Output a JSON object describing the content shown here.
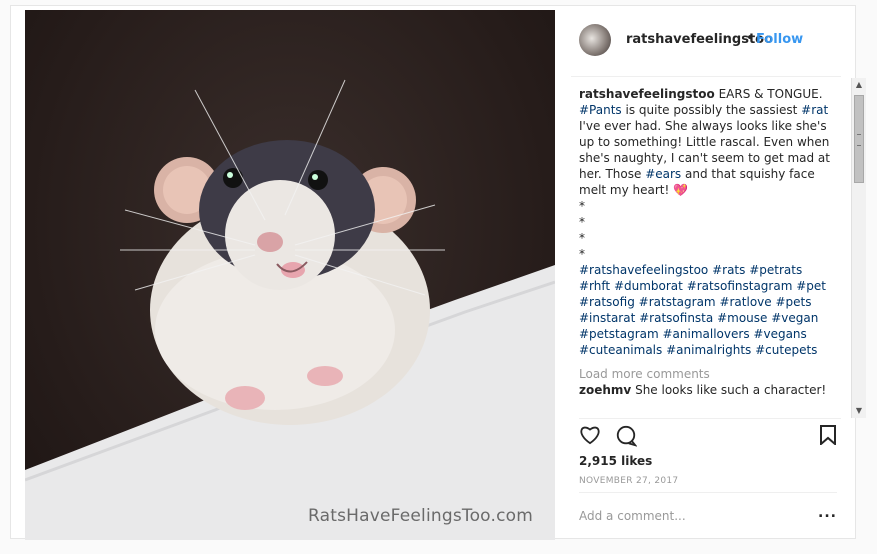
{
  "post": {
    "username": "ratshavefeelingstoo",
    "separator": "•",
    "follow_label": "Follow",
    "watermark": "RatsHaveFeelingsToo.com",
    "caption": {
      "user": "ratshavefeelingstoo",
      "title": "EARS & TONGUE.",
      "tag_pants": "#Pants",
      "text1": "is quite possibly the sassiest",
      "tag_rat": "#rat",
      "text2": "I've ever had. She always looks like she's up to something! Little rascal. Even when she's naughty, I can't seem to get mad at her. Those",
      "tag_ears": "#ears",
      "text3": "and that squishy face melt my heart!",
      "emoji": "💖",
      "stars": [
        "*",
        "*",
        "*",
        "*"
      ],
      "hashtags": [
        "#ratshavefeelingstoo",
        "#rats",
        "#petrats",
        "#rhft",
        "#dumborat",
        "#ratsofinstagram",
        "#pet",
        "#ratsofig",
        "#ratstagram",
        "#ratlove",
        "#pets",
        "#instarat",
        "#ratsofinsta",
        "#mouse",
        "#vegan",
        "#petstagram",
        "#animallovers",
        "#vegans",
        "#cuteanimals",
        "#animalrights",
        "#cutepets"
      ]
    },
    "load_more": "Load more comments",
    "comment": {
      "user": "zoehmv",
      "text": "She looks like such a character!"
    },
    "likes": "2,915 likes",
    "date": "NOVEMBER 27, 2017",
    "add_comment_placeholder": "Add a comment...",
    "more_icon": "...",
    "icons": {
      "like": "heart-icon",
      "comment": "comment-icon",
      "save": "bookmark-icon"
    }
  }
}
